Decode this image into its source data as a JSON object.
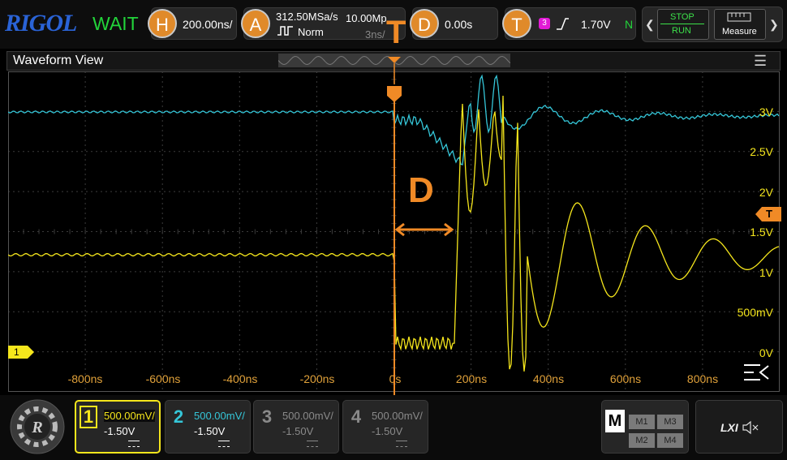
{
  "header": {
    "brand": "RIGOL",
    "status": "WAIT",
    "horizontal": {
      "badge": "H",
      "scale": "200.00ns/"
    },
    "acquire": {
      "badge": "A",
      "sample_rate": "312.50MSa/s",
      "mem_depth": "10.00Mp",
      "mode": "Norm",
      "time": "3ns/"
    },
    "delay": {
      "badge": "D",
      "value": "0.00s"
    },
    "trigger": {
      "badge": "T",
      "source": "3",
      "level": "1.70V",
      "mode": "N"
    },
    "stop_label": "STOP",
    "run_label": "RUN",
    "measure_label": "Measure"
  },
  "waveform_view": {
    "title": "Waveform View",
    "time_ticks": [
      "-800ns",
      "-600ns",
      "-400ns",
      "-200ns",
      "0s",
      "200ns",
      "400ns",
      "600ns",
      "800ns"
    ],
    "volt_ticks": [
      "3V",
      "2.5V",
      "2V",
      "1.5V",
      "1V",
      "500mV",
      "0V"
    ],
    "trigger_marker": "T",
    "delay_marker": "D",
    "ch1_ground_marker": "1"
  },
  "channels": [
    {
      "num": "1",
      "scale": "500.00mV/",
      "offset": "-1.50V",
      "color": "#f5e61c",
      "active": true
    },
    {
      "num": "2",
      "scale": "500.00mV/",
      "offset": "-1.50V",
      "color": "#35c6d8",
      "active": true
    },
    {
      "num": "3",
      "scale": "500.00mV/",
      "offset": "-1.50V",
      "color": "#8a8a8a",
      "active": false
    },
    {
      "num": "4",
      "scale": "500.00mV/",
      "offset": "-1.50V",
      "color": "#8a8a8a",
      "active": false
    }
  ],
  "math": {
    "label": "M",
    "items": [
      "M1",
      "M3",
      "M2",
      "M4"
    ]
  },
  "lxi_label": "LXI",
  "colors": {
    "ch1": "#f5e61c",
    "ch2": "#35c6d8",
    "marker": "#f08a26",
    "grid": "#3c3c3c"
  }
}
